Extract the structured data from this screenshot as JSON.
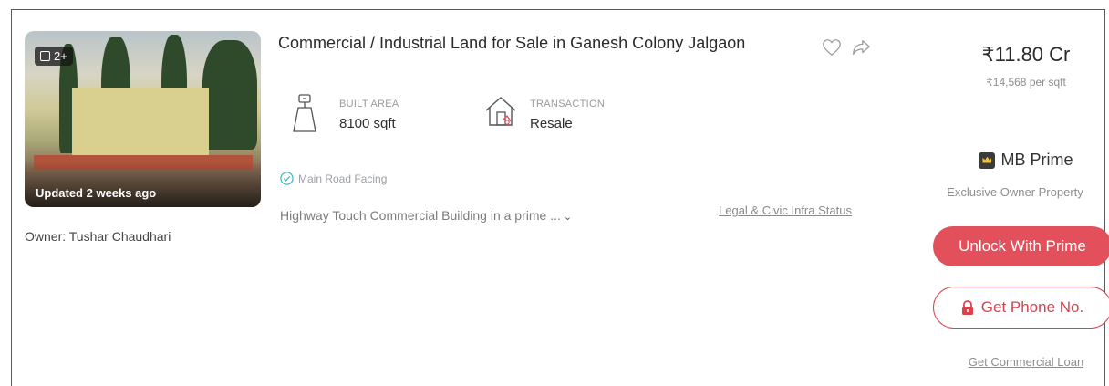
{
  "listing": {
    "photo_count": "2+",
    "updated": "Updated 2 weeks ago",
    "owner": "Owner: Tushar Chaudhari",
    "title": "Commercial / Industrial Land for Sale in Ganesh Colony Jalgaon",
    "attributes": [
      {
        "label": "BUILT AREA",
        "value": "8100 sqft",
        "icon": "area-icon"
      },
      {
        "label": "TRANSACTION",
        "value": "Resale",
        "icon": "house-icon"
      }
    ],
    "facing": "Main Road Facing",
    "description": "Highway Touch Commercial Building in a prime ...",
    "legal_link": "Legal & Civic Infra Status"
  },
  "pricing": {
    "price": "₹11.80 Cr",
    "per_sqft": "₹14,568 per sqft"
  },
  "prime": {
    "label": "MB Prime",
    "subtitle": "Exclusive Owner Property",
    "unlock_label": "Unlock With Prime",
    "phone_label": "Get Phone No.",
    "loan_label": "Get Commercial Loan"
  },
  "colors": {
    "accent": "#e2515b",
    "prime_crown": "#f2c23a",
    "facing_check": "#3fb6c9"
  }
}
